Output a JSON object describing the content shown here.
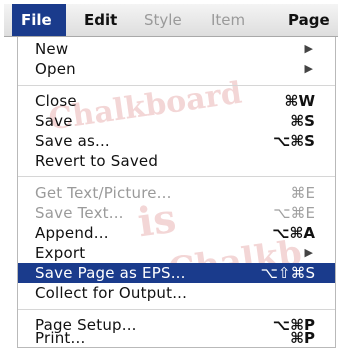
{
  "menubar": {
    "items": [
      {
        "label": "File"
      },
      {
        "label": "Edit"
      },
      {
        "label": "Style"
      },
      {
        "label": "Item"
      },
      {
        "label": "Page"
      }
    ]
  },
  "menu": {
    "items": [
      {
        "label": "New",
        "shortcut": "",
        "submenu": true
      },
      {
        "label": "Open",
        "shortcut": "",
        "submenu": true
      },
      {
        "label": "Close",
        "shortcut": "⌘W"
      },
      {
        "label": "Save",
        "shortcut": "⌘S"
      },
      {
        "label": "Save as...",
        "shortcut": "⌥⌘S"
      },
      {
        "label": "Revert to Saved",
        "shortcut": ""
      },
      {
        "label": "Get Text/Picture...",
        "shortcut": "⌘E",
        "disabled": true
      },
      {
        "label": "Save Text...",
        "shortcut": "⌥⌘E",
        "disabled": true
      },
      {
        "label": "Append...",
        "shortcut": "⌥⌘A"
      },
      {
        "label": "Export",
        "shortcut": "",
        "submenu": true
      },
      {
        "label": "Save Page as EPS...",
        "shortcut": "⌥⇧⌘S",
        "highlighted": true
      },
      {
        "label": "Collect for Output...",
        "shortcut": ""
      },
      {
        "label": "Page Setup...",
        "shortcut": "⌥⌘P"
      },
      {
        "label": "Print...",
        "shortcut": "⌘P"
      }
    ],
    "submenu_arrow": "▶"
  },
  "colors": {
    "highlight": "#1a3b8c",
    "disabled_text": "#9a9a9a"
  }
}
